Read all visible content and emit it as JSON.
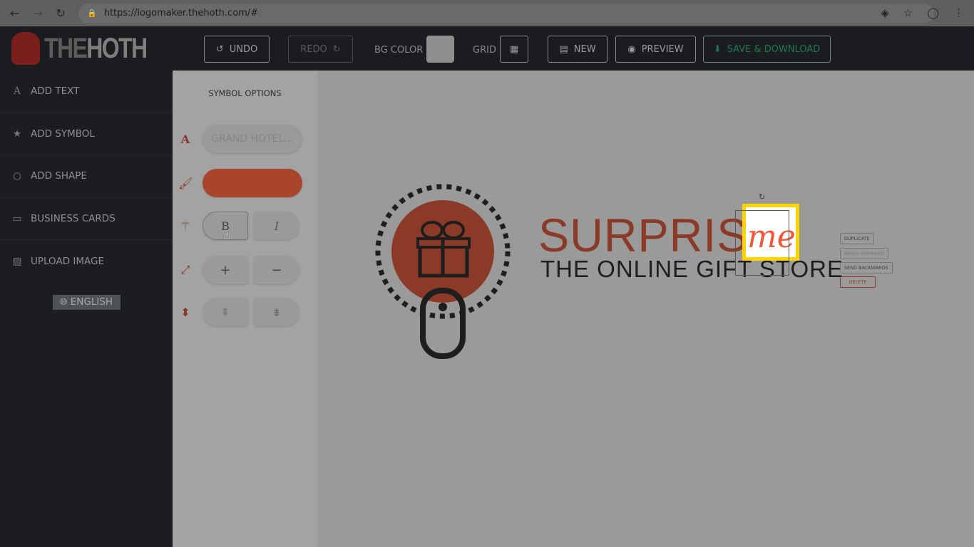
{
  "browser": {
    "url": "https://logomaker.thehoth.com/#"
  },
  "header": {
    "logo_the": "THE",
    "logo_hoth": "HOTH",
    "undo": "UNDO",
    "redo": "REDO",
    "bg_color": "BG COLOR",
    "grid": "GRID",
    "new": "NEW",
    "preview": "PREVIEW",
    "save": "SAVE & DOWNLOAD"
  },
  "sidebar": {
    "items": [
      {
        "label": "ADD TEXT"
      },
      {
        "label": "ADD SYMBOL"
      },
      {
        "label": "ADD SHAPE"
      },
      {
        "label": "BUSINESS CARDS"
      },
      {
        "label": "UPLOAD IMAGE"
      }
    ],
    "language": "ENGLISH"
  },
  "options": {
    "title": "SYMBOL OPTIONS",
    "font": "GRAND HOTEL...",
    "color": "#a8452b",
    "bold": "B",
    "italic": "I",
    "plus": "+",
    "minus": "−"
  },
  "logo": {
    "brand": "SURPRISE",
    "accent": "me",
    "tagline": "THE ONLINE GIFT STORE",
    "brand_color": "#a8452b",
    "accent_color": "#f0573a"
  },
  "context_menu": {
    "duplicate": "DUPLICATE",
    "bring_forward": "BRING FORWARD",
    "send_backwards": "SEND BACKWARDS",
    "delete": "DELETE"
  }
}
